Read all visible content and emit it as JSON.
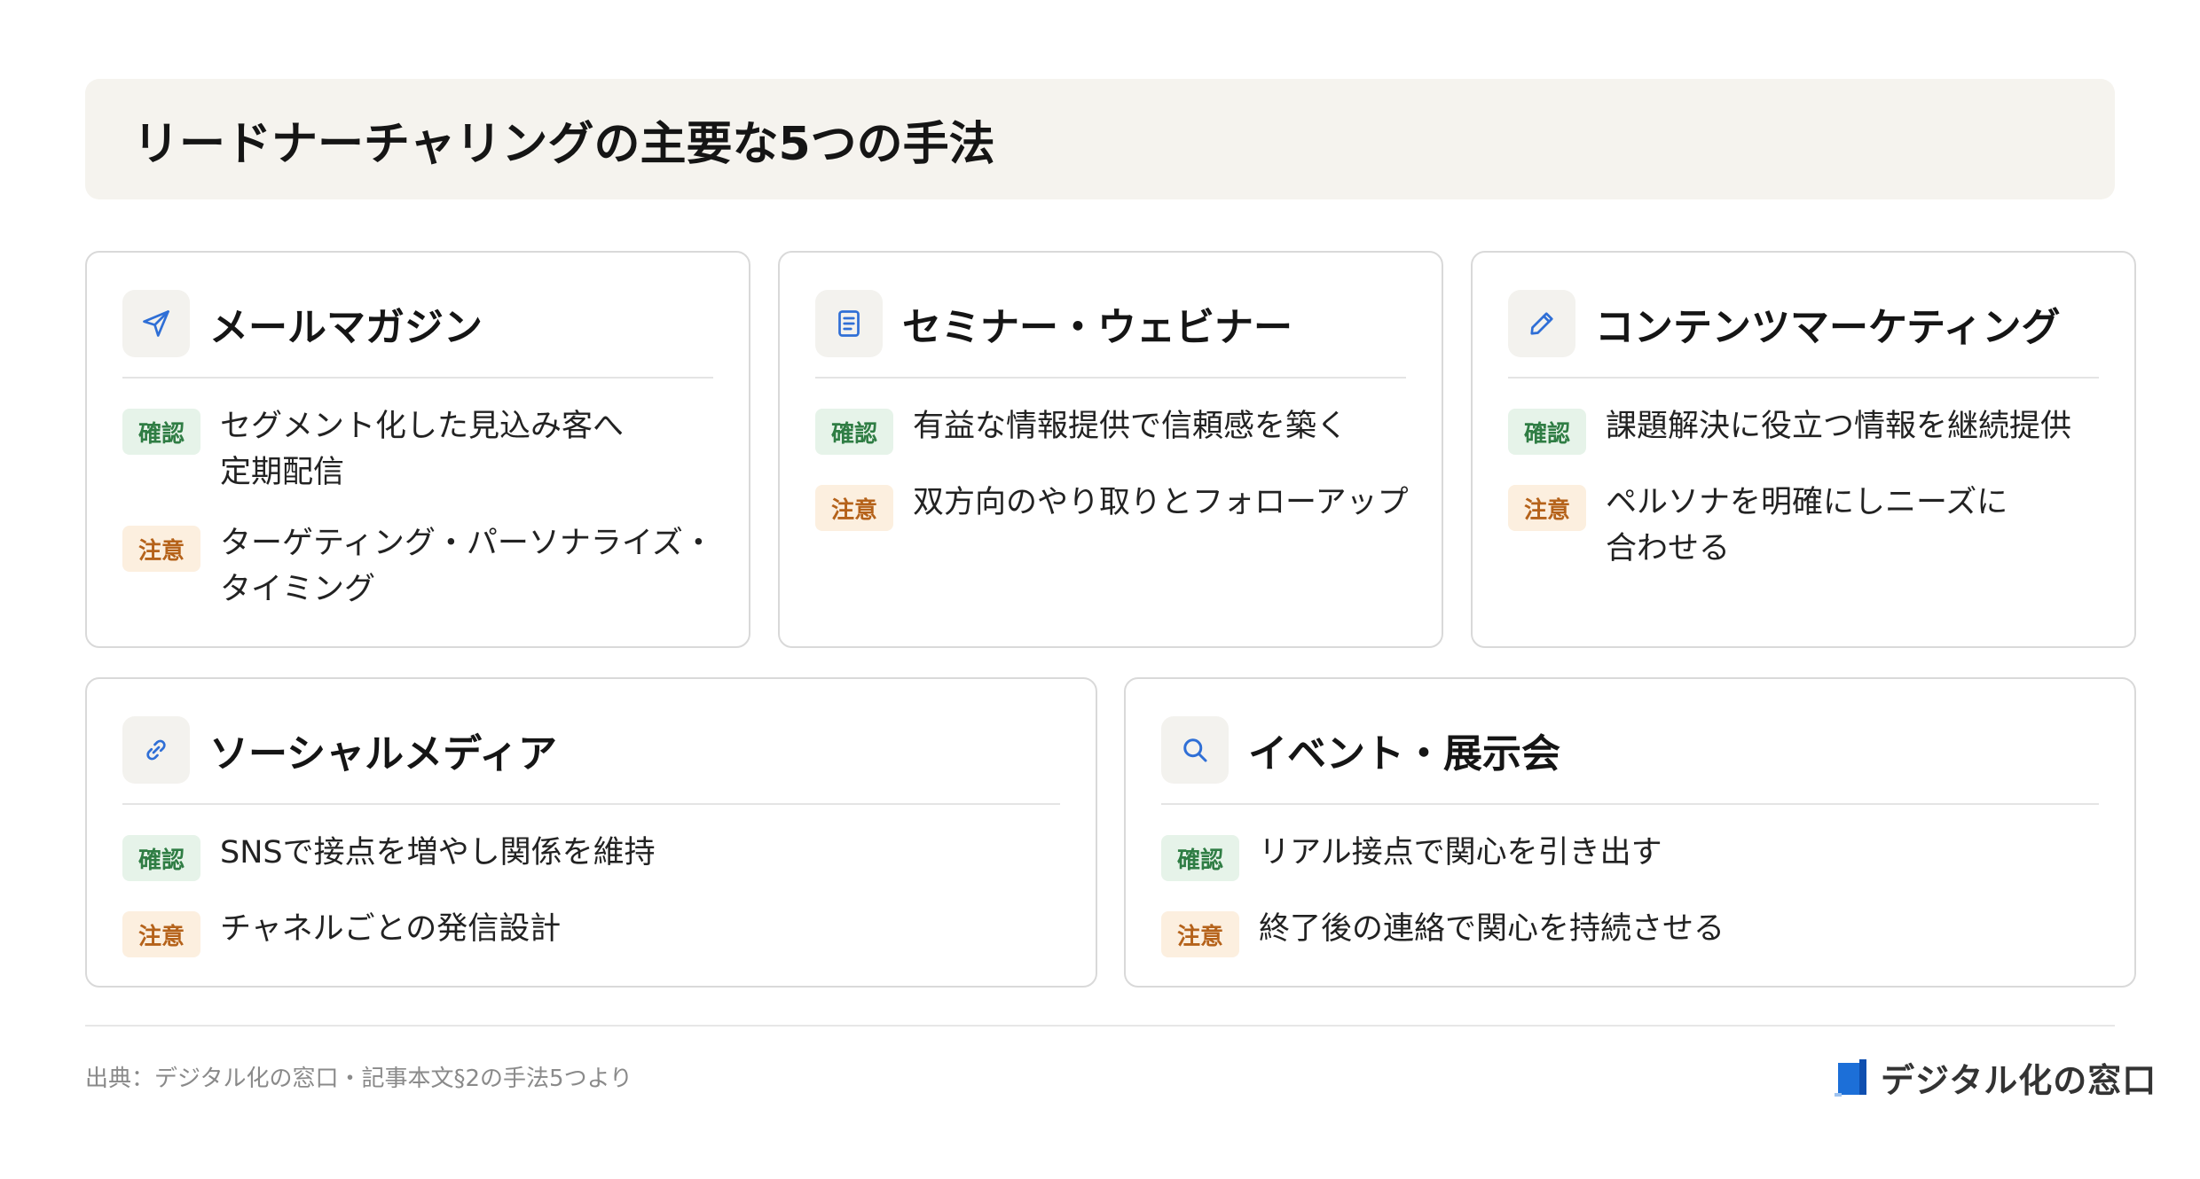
{
  "title": "リードナーチャリングの主要な5つの手法",
  "badges": {
    "confirm": "確認",
    "caution": "注意"
  },
  "cards": [
    {
      "title": "メールマガジン",
      "icon": "send-icon",
      "confirm": "セグメント化した見込み客へ\n定期配信",
      "caution": "ターゲティング・パーソナライズ・\nタイミング"
    },
    {
      "title": "セミナー・ウェビナー",
      "icon": "document-icon",
      "confirm": "有益な情報提供で信頼感を築く",
      "caution": "双方向のやり取りとフォローアップ"
    },
    {
      "title": "コンテンツマーケティング",
      "icon": "pencil-icon",
      "confirm": "課題解決に役立つ情報を継続提供",
      "caution": "ペルソナを明確にしニーズに\n合わせる"
    },
    {
      "title": "ソーシャルメディア",
      "icon": "link-icon",
      "confirm": "SNSで接点を増やし関係を維持",
      "caution": "チャネルごとの発信設計"
    },
    {
      "title": "イベント・展示会",
      "icon": "search-icon",
      "confirm": "リアル接点で関心を引き出す",
      "caution": "終了後の連絡で関心を持続させる"
    }
  ],
  "footer": {
    "source": "出典：デジタル化の窓口・記事本文§2の手法5つより",
    "logo": "デジタル化の窓口"
  },
  "colors": {
    "icon_blue": "#2f6fd6",
    "confirm_bg": "#e6f3e9",
    "confirm_fg": "#2f7d44",
    "caution_bg": "#fcefdf",
    "caution_fg": "#b5621a",
    "title_bg": "#f5f3ee",
    "logo_blue": "#1c6fd8"
  }
}
